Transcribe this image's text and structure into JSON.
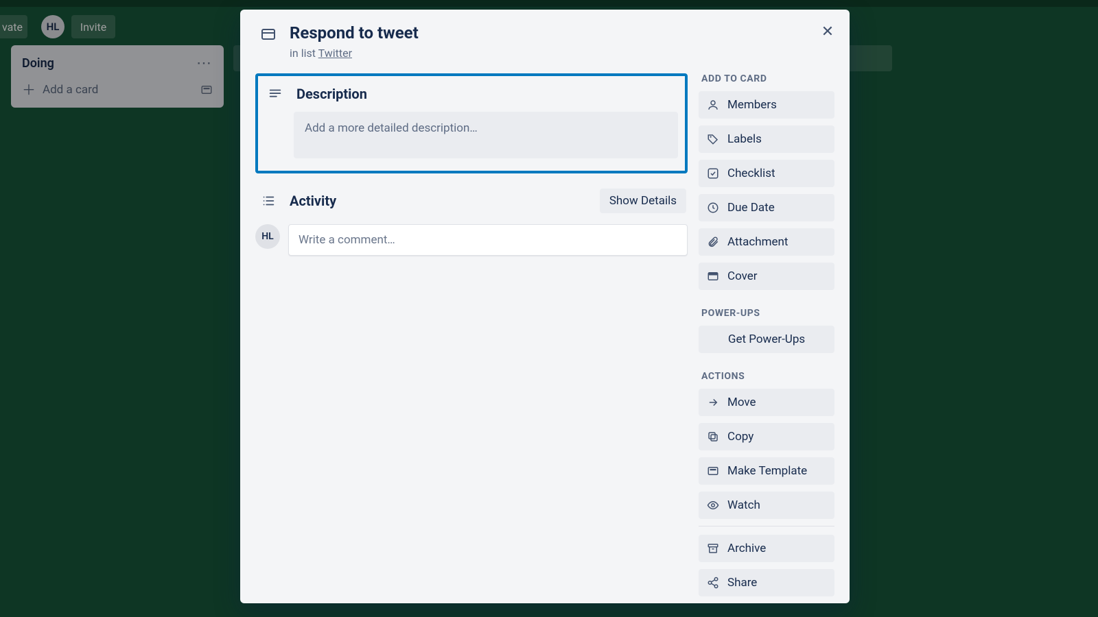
{
  "board": {
    "vate_label": "vate",
    "avatar_initials": "HL",
    "invite_label": "Invite",
    "list": {
      "title": "Doing",
      "add_card_label": "Add a card"
    }
  },
  "card": {
    "title": "Respond to tweet",
    "inlist_prefix": "in list ",
    "list_link": "Twitter",
    "description": {
      "heading": "Description",
      "placeholder": "Add a more detailed description…"
    },
    "activity": {
      "heading": "Activity",
      "show_details": "Show Details",
      "comment_placeholder": "Write a comment…",
      "avatar_initials": "HL"
    }
  },
  "sidebar": {
    "add_to_card_heading": "ADD TO CARD",
    "add_items": [
      {
        "icon": "user",
        "label": "Members"
      },
      {
        "icon": "tag",
        "label": "Labels"
      },
      {
        "icon": "check",
        "label": "Checklist"
      },
      {
        "icon": "clock",
        "label": "Due Date"
      },
      {
        "icon": "paperclip",
        "label": "Attachment"
      },
      {
        "icon": "cover",
        "label": "Cover"
      }
    ],
    "powerups_heading": "POWER-UPS",
    "powerups_label": "Get Power-Ups",
    "actions_heading": "ACTIONS",
    "actions": [
      {
        "icon": "arrow",
        "label": "Move"
      },
      {
        "icon": "copy",
        "label": "Copy"
      },
      {
        "icon": "template",
        "label": "Make Template"
      },
      {
        "icon": "eye",
        "label": "Watch"
      }
    ],
    "archive_label": "Archive",
    "share_label": "Share"
  }
}
